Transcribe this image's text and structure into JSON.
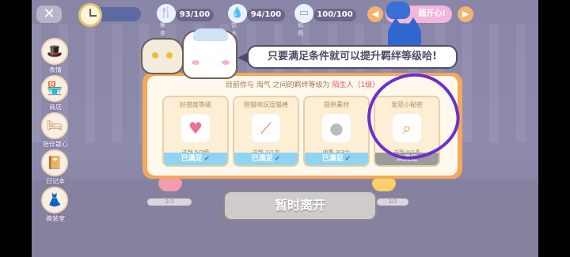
{
  "hud": {
    "close_label": "✕",
    "time_text": "",
    "stats": [
      {
        "name": "food",
        "icon": "fork-knife-icon",
        "value": "93/100",
        "caption": "餐食"
      },
      {
        "name": "water",
        "icon": "water-bottle-icon",
        "value": "94/100",
        "caption": "饮水"
      },
      {
        "name": "clean",
        "icon": "box-icon",
        "value": "100/100",
        "caption": "如厕"
      }
    ],
    "mood": {
      "text": "超开心!",
      "caption": "心情"
    }
  },
  "menu": [
    {
      "label": "表情",
      "icon": "hat-icon"
    },
    {
      "label": "商店",
      "icon": "shop-icon"
    },
    {
      "label": "陪伴散心",
      "icon": "bed-icon"
    },
    {
      "label": "日记本",
      "icon": "diary-icon"
    },
    {
      "label": "换装室",
      "icon": "wardrobe-icon"
    }
  ],
  "dialog": {
    "speech": "只要满足条件就可以提升羁绊等级哈!",
    "header_prefix": "目前你与 淘气 之间的羁绊等级为",
    "rank": "陌生人（1级）",
    "cards": [
      {
        "title": "好感度等级",
        "icon": "heart-icon",
        "progress": "达到 5/2级",
        "status": "已满足",
        "met": true
      },
      {
        "title": "陪猫咪玩逗猫棒",
        "icon": "cat-teaser-icon",
        "progress": "达到 1/1次",
        "status": "已满足",
        "met": true
      },
      {
        "title": "提供素材",
        "icon": "ball-icon",
        "progress": "收集 3/3个",
        "status": "已满足",
        "met": true
      },
      {
        "title": "发现小秘密",
        "icon": "magnifier-icon",
        "progress": "达到 0/1条",
        "status": "未满足",
        "met": false
      }
    ]
  },
  "leave_button": "暂时离开",
  "floor_bar_left": "2/3",
  "floor_bar_right": "3/3",
  "colors": {
    "panel_border": "#f5a85a",
    "met_status": "#8fd5f1",
    "highlight": "#6b2fd0"
  }
}
